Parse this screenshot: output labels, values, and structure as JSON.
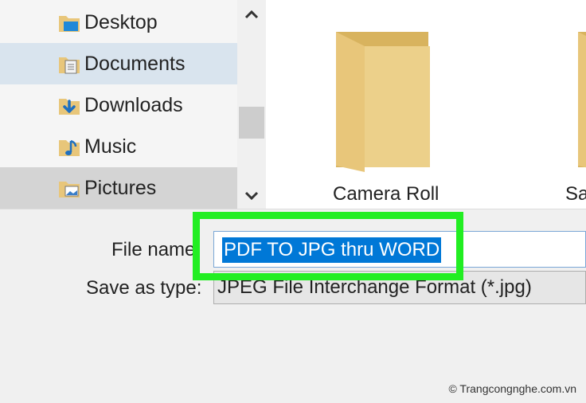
{
  "nav": {
    "items": [
      {
        "label": "Desktop",
        "icon": "desktop-folder-icon"
      },
      {
        "label": "Documents",
        "icon": "documents-folder-icon"
      },
      {
        "label": "Downloads",
        "icon": "downloads-folder-icon"
      },
      {
        "label": "Music",
        "icon": "music-folder-icon"
      },
      {
        "label": "Pictures",
        "icon": "pictures-folder-icon"
      }
    ]
  },
  "files": {
    "items": [
      {
        "label": "Camera Roll"
      },
      {
        "label": "Sa"
      }
    ]
  },
  "form": {
    "filename_label": "File name",
    "filename_value": "PDF TO JPG thru WORD",
    "savetype_label": "Save as type:",
    "savetype_value": "JPEG File Interchange Format (*.jpg)"
  },
  "watermark": "© Trangcongnghe.com.vn",
  "colors": {
    "highlight": "#22ee22",
    "selection": "#0078d7",
    "folder": "#e8c67a"
  }
}
